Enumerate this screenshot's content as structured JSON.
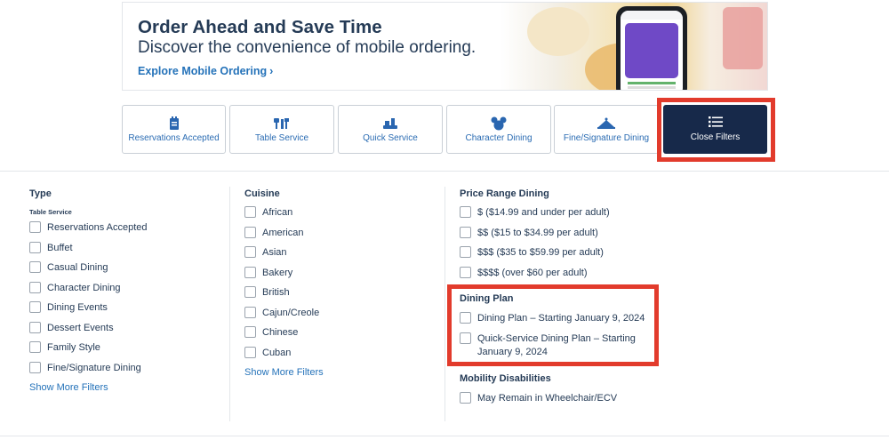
{
  "banner": {
    "title": "Order Ahead and Save Time",
    "subtitle": "Discover the convenience of mobile ordering.",
    "link_label": "Explore Mobile Ordering",
    "link_chevron": "›"
  },
  "tabs": [
    {
      "label": "Reservations Accepted",
      "icon": "reservation-icon"
    },
    {
      "label": "Table Service",
      "icon": "utensils-icon"
    },
    {
      "label": "Quick Service",
      "icon": "tray-icon"
    },
    {
      "label": "Character Dining",
      "icon": "mickey-icon"
    },
    {
      "label": "Fine/Signature Dining",
      "icon": "fine-dining-icon"
    }
  ],
  "close_filters": {
    "label": "Close Filters",
    "icon": "list-icon"
  },
  "type_col": {
    "title": "Type",
    "sub_title": "Table Service",
    "options": [
      "Reservations Accepted",
      "Buffet",
      "Casual Dining",
      "Character Dining",
      "Dining Events",
      "Dessert Events",
      "Family Style",
      "Fine/Signature Dining"
    ],
    "show_more": "Show More Filters"
  },
  "cuisine_col": {
    "title": "Cuisine",
    "options": [
      "African",
      "American",
      "Asian",
      "Bakery",
      "British",
      "Cajun/Creole",
      "Chinese",
      "Cuban"
    ],
    "show_more": "Show More Filters"
  },
  "price_col": {
    "title": "Price Range Dining",
    "options": [
      "$ ($14.99 and under per adult)",
      "$$ ($15 to $34.99 per adult)",
      "$$$ ($35 to $59.99 per adult)",
      "$$$$ (over $60 per adult)"
    ]
  },
  "dining_plan": {
    "title": "Dining Plan",
    "options": [
      "Dining Plan – Starting January 9, 2024",
      "Quick-Service Dining Plan – Starting",
      "January 9, 2024"
    ]
  },
  "mobility": {
    "title": "Mobility Disabilities",
    "options": [
      "May Remain in Wheelchair/ECV"
    ]
  },
  "colors": {
    "accent": "#2472b9",
    "navy": "#17294a",
    "highlight": "#e23b2c"
  }
}
